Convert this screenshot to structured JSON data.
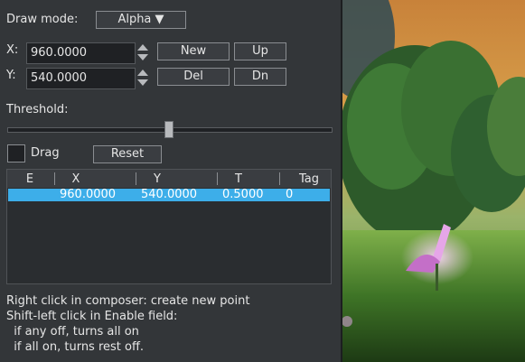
{
  "draw_mode": {
    "label": "Draw mode:",
    "value": "Alpha"
  },
  "x_field": {
    "label": "X:",
    "value": "960.0000"
  },
  "y_field": {
    "label": "Y:",
    "value": "540.0000"
  },
  "buttons": {
    "new": "New",
    "up": "Up",
    "del": "Del",
    "dn": "Dn",
    "reset": "Reset"
  },
  "threshold": {
    "label": "Threshold:",
    "value": 0.5
  },
  "drag": {
    "label": "Drag",
    "checked": false
  },
  "table": {
    "headers": [
      "E",
      "X",
      "Y",
      "T",
      "Tag"
    ],
    "rows": [
      {
        "e": "",
        "x": "960.0000",
        "y": "540.0000",
        "t": "0.5000",
        "tag": "0"
      }
    ]
  },
  "help_lines": [
    "Right click in composer: create new point",
    "Shift-left click in Enable field:",
    "  if any off, turns all on",
    "  if all on, turns rest off."
  ],
  "colors": {
    "selection": "#3daee9",
    "panel": "#333639"
  }
}
